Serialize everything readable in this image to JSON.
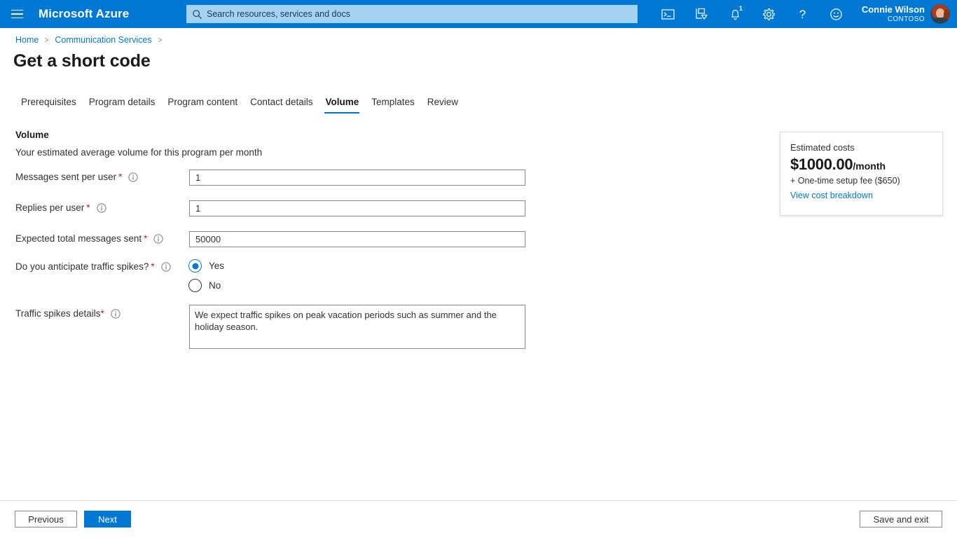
{
  "topbar": {
    "menu_icon": "hamburger-icon",
    "brand": "Microsoft Azure",
    "search_placeholder": "Search resources, services and docs",
    "search_value": "",
    "icons": [
      {
        "name": "cloud-shell-icon",
        "label": "Cloud Shell"
      },
      {
        "name": "directories-subscriptions-icon",
        "label": "Directories + subscriptions"
      },
      {
        "name": "notifications-bell-icon",
        "label": "Notifications",
        "badge": "1"
      },
      {
        "name": "settings-gear-icon",
        "label": "Settings"
      },
      {
        "name": "help-question-icon",
        "label": "Help"
      },
      {
        "name": "feedback-smiley-icon",
        "label": "Feedback"
      }
    ],
    "user": {
      "name": "Connie Wilson",
      "org": "CONTOSO"
    }
  },
  "breadcrumb": {
    "items": [
      {
        "label": "Home"
      },
      {
        "label": "Communication Services"
      }
    ],
    "separator": ">"
  },
  "page": {
    "title": "Get a short code"
  },
  "tabs": [
    {
      "label": "Prerequisites",
      "active": false
    },
    {
      "label": "Program details",
      "active": false
    },
    {
      "label": "Program content",
      "active": false
    },
    {
      "label": "Contact details",
      "active": false
    },
    {
      "label": "Volume",
      "active": true
    },
    {
      "label": "Templates",
      "active": false
    },
    {
      "label": "Review",
      "active": false
    }
  ],
  "form": {
    "section_title": "Volume",
    "section_subtitle": "Your estimated average volume for this program per month",
    "fields": {
      "messages_sent": {
        "label": "Messages sent per user",
        "required_mark": "*",
        "value": "1",
        "placeholder": ""
      },
      "replies": {
        "label": "Replies per user",
        "required_mark": "*",
        "value": "1",
        "placeholder": ""
      },
      "expected_total": {
        "label": "Expected total messages sent",
        "required_mark": "*",
        "value": "50000",
        "placeholder": ""
      },
      "traffic_spikes": {
        "label": "Do you anticipate traffic spikes?",
        "required_mark": "*",
        "options": [
          {
            "label": "Yes",
            "selected": true
          },
          {
            "label": "No",
            "selected": false
          }
        ]
      },
      "spikes_details": {
        "label": "Traffic spikes details",
        "required_mark": "*",
        "value": "We expect traffic spikes on peak vacation periods such as summer and the holiday season.",
        "placeholder": ""
      }
    }
  },
  "cost_card": {
    "heading": "Estimated costs",
    "amount": "$1000.00",
    "period": "/month",
    "setup_fee": "+ One-time setup fee ($650)",
    "link": "View cost breakdown"
  },
  "footer": {
    "previous": "Previous",
    "next": "Next",
    "save_and_exit": "Save and exit"
  },
  "colors": {
    "azure_blue": "#0078d4",
    "search_bg": "#a5d2f0",
    "required_red": "#a4262c",
    "text_primary": "#1b1a19",
    "text_secondary": "#323130",
    "border": "#8a8886"
  }
}
